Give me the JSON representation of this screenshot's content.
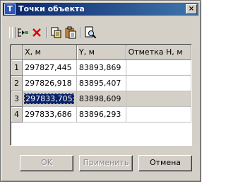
{
  "window": {
    "title": "Точки объекта",
    "app_icon_letter": "T",
    "close_glyph": "×"
  },
  "toolbar": {
    "buttons": [
      {
        "icon": "insert-point-icon"
      },
      {
        "icon": "delete-x-icon",
        "color": "#e00000"
      },
      {
        "icon": "copy-icon"
      },
      {
        "icon": "paste-icon"
      },
      {
        "icon": "preview-magnify-icon"
      }
    ]
  },
  "table": {
    "headers": [
      "X, м",
      "Y, м",
      "Отметка Н, м"
    ],
    "rows": [
      {
        "num": "1",
        "x": "297827,445",
        "y": "83893,869",
        "h": ""
      },
      {
        "num": "2",
        "x": "297826,918",
        "y": "83895,407",
        "h": ""
      },
      {
        "num": "3",
        "x": "297833,705",
        "y": "83898,609",
        "h": ""
      },
      {
        "num": "4",
        "x": "297833,686",
        "y": "83896,293",
        "h": ""
      }
    ],
    "selected_row": 3
  },
  "buttons": {
    "ok": "OK",
    "apply": "Применить",
    "cancel": "Отмена"
  },
  "colors": {
    "title_bar": "#0a246a",
    "selection": "#0a246a",
    "face": "#d4d0c8"
  }
}
